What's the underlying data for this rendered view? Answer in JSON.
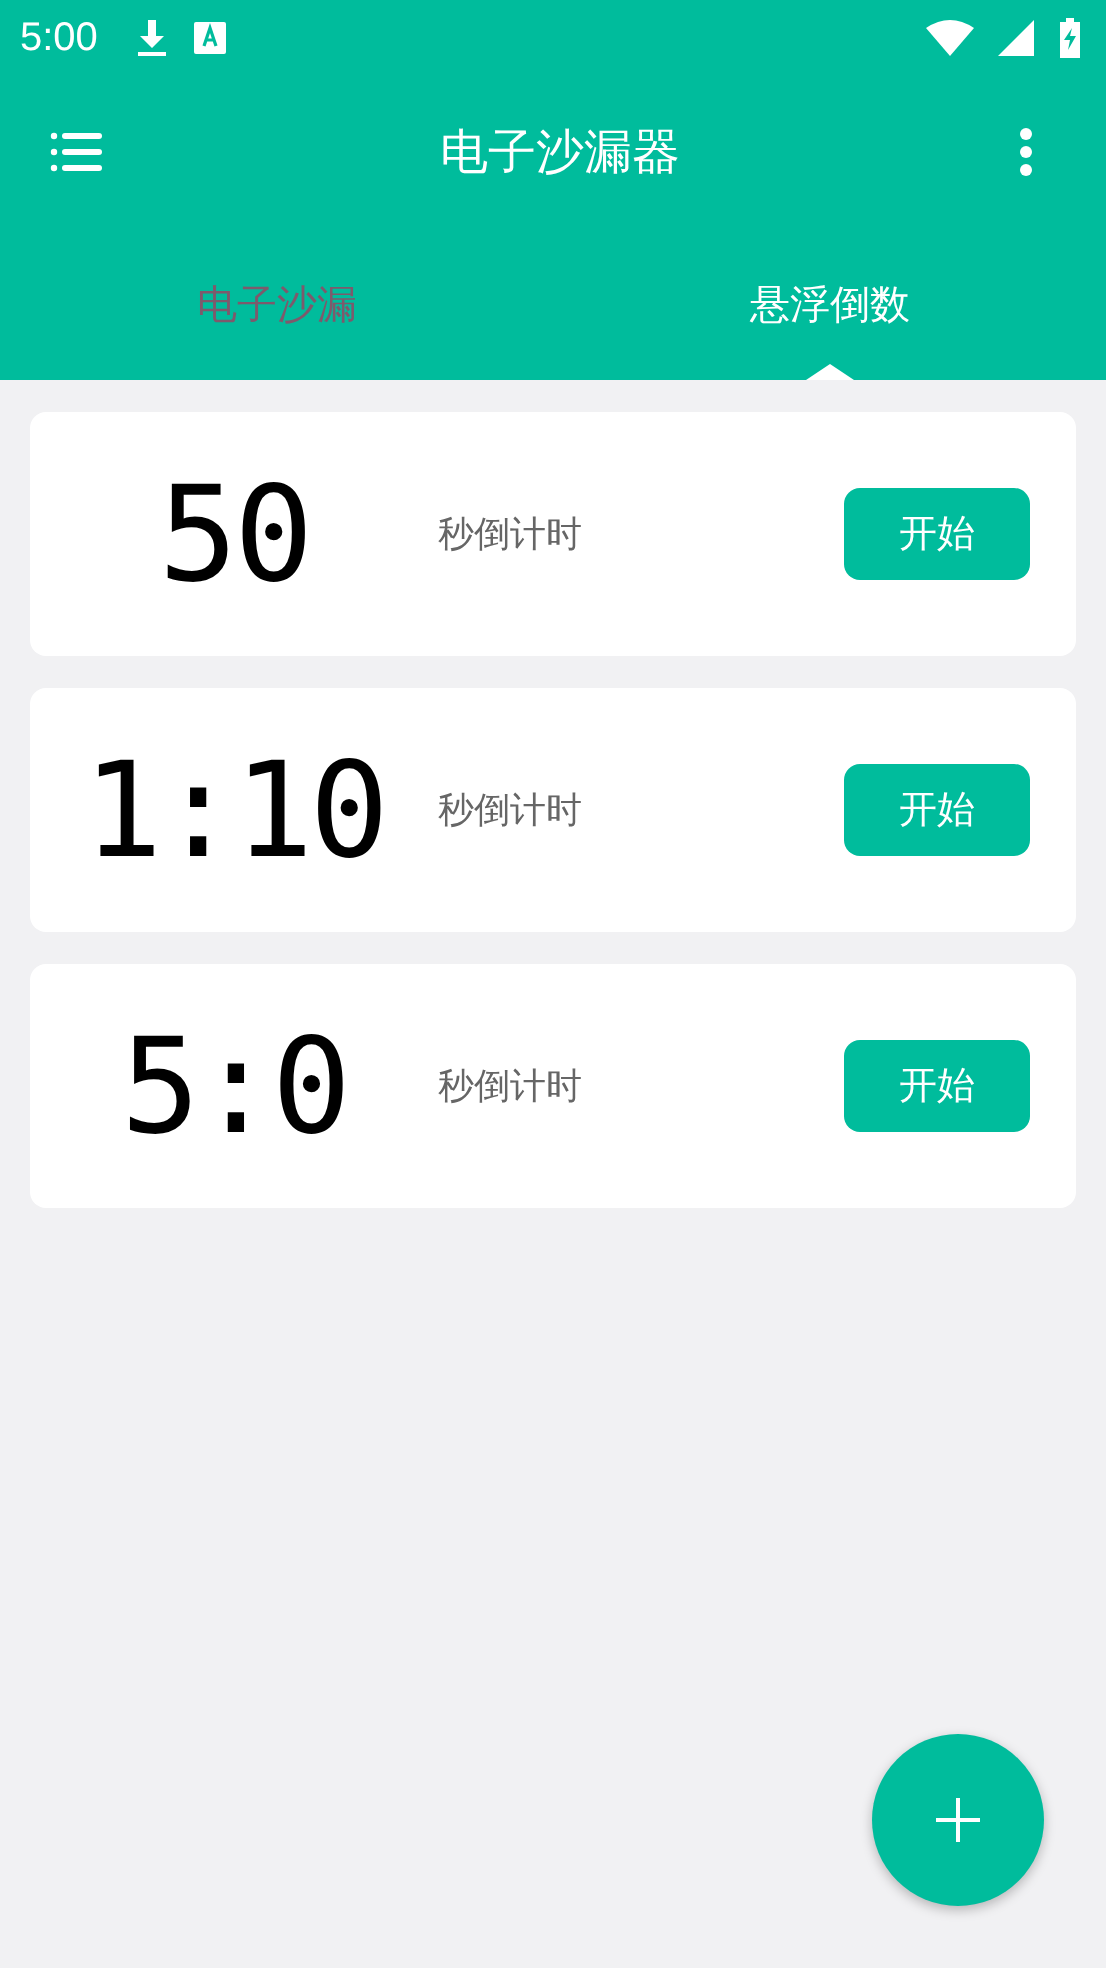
{
  "status_bar": {
    "time": "5:00"
  },
  "app_bar": {
    "title": "电子沙漏器"
  },
  "tabs": [
    {
      "label": "电子沙漏",
      "selected": false
    },
    {
      "label": "悬浮倒数",
      "selected": true
    }
  ],
  "timers": [
    {
      "display": "50",
      "label": "秒倒计时",
      "button": "开始"
    },
    {
      "display": "1:10",
      "label": "秒倒计时",
      "button": "开始"
    },
    {
      "display": "5:0",
      "label": "秒倒计时",
      "button": "开始"
    }
  ]
}
